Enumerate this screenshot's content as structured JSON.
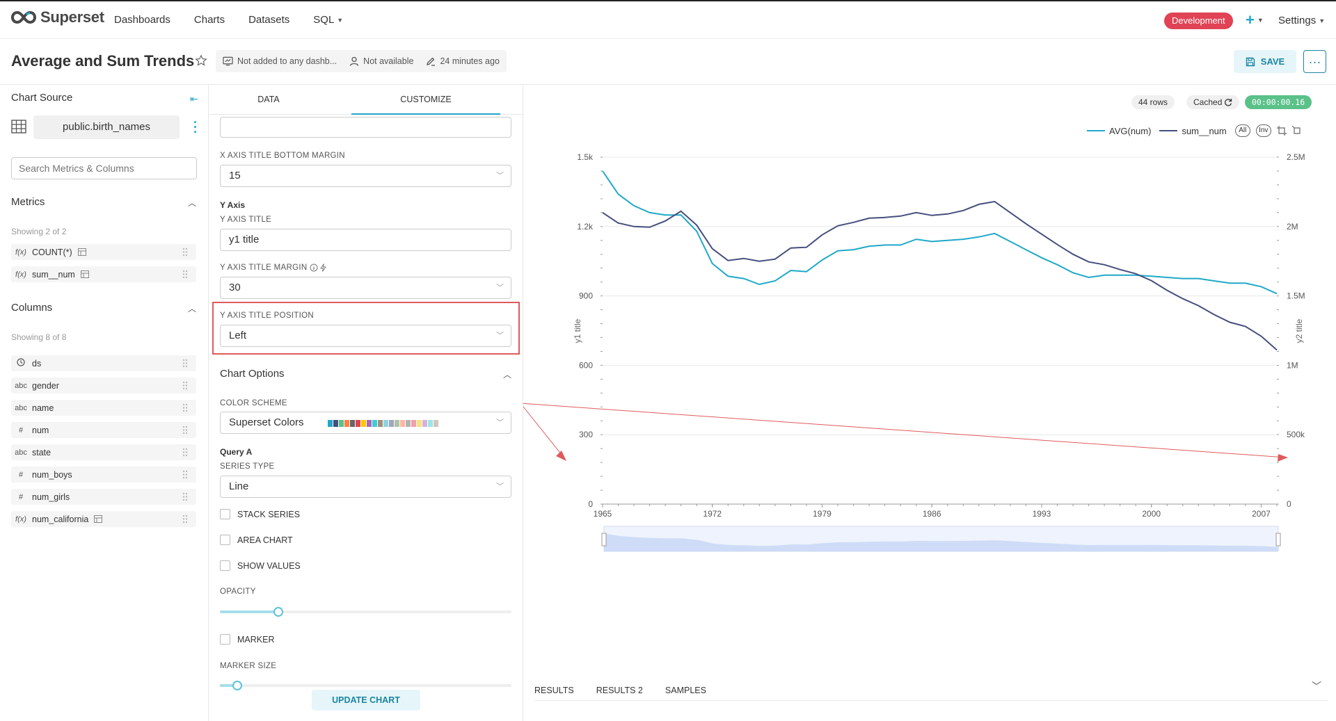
{
  "topbar": {
    "brand": "Superset",
    "nav": [
      {
        "label": "Dashboards"
      },
      {
        "label": "Charts"
      },
      {
        "label": "Datasets"
      },
      {
        "label": "SQL"
      }
    ],
    "env_badge": "Development",
    "settings_label": "Settings"
  },
  "header": {
    "title": "Average and Sum Trends",
    "meta": {
      "dashboards": "Not added to any dashb...",
      "owner": "Not available",
      "modified": "24 minutes ago"
    },
    "save_label": "SAVE",
    "more_label": "···"
  },
  "left": {
    "chart_source_label": "Chart Source",
    "dataset_name": "public.birth_names",
    "search_placeholder": "Search Metrics & Columns",
    "metrics_label": "Metrics",
    "metrics_showing": "Showing 2 of 2",
    "metrics": [
      {
        "icon": "f(x)",
        "name": "COUNT(*)"
      },
      {
        "icon": "f(x)",
        "name": "sum__num"
      }
    ],
    "columns_label": "Columns",
    "columns_showing": "Showing 8 of 8",
    "columns": [
      {
        "icon": "clock",
        "name": "ds"
      },
      {
        "icon": "abc",
        "name": "gender"
      },
      {
        "icon": "abc",
        "name": "name"
      },
      {
        "icon": "#",
        "name": "num"
      },
      {
        "icon": "abc",
        "name": "state"
      },
      {
        "icon": "#",
        "name": "num_boys"
      },
      {
        "icon": "#",
        "name": "num_girls"
      },
      {
        "icon": "f(x)",
        "name": "num_california"
      }
    ]
  },
  "mid": {
    "tabs": [
      {
        "label": "DATA"
      },
      {
        "label": "CUSTOMIZE"
      }
    ],
    "x_axis_title_bottom_margin_label": "X AXIS TITLE BOTTOM MARGIN",
    "x_axis_title_bottom_margin": "15",
    "y_axis_heading": "Y Axis",
    "y_axis_title_label": "Y AXIS TITLE",
    "y_axis_title": "y1 title",
    "y_axis_title_margin_label": "Y AXIS TITLE MARGIN",
    "y_axis_title_margin": "30",
    "y_axis_title_position_label": "Y AXIS TITLE POSITION",
    "y_axis_title_position": "Left",
    "chart_options_label": "Chart Options",
    "color_scheme_label": "COLOR SCHEME",
    "color_scheme": "Superset Colors",
    "color_swatches": [
      "#1fa8c9",
      "#454e7c",
      "#5ac189",
      "#ff7f44",
      "#666666",
      "#e04355",
      "#fcc700",
      "#a868b7",
      "#3cccda",
      "#a38f79",
      "#8fd3e4",
      "#a1a6bd",
      "#acc3a8",
      "#fdb8a2",
      "#b2b2b2",
      "#efa1aa",
      "#fddf80",
      "#d3b3da",
      "#9ee5e5",
      "#d1c6bc"
    ],
    "query_a_label": "Query A",
    "series_type_label": "SERIES TYPE",
    "series_type": "Line",
    "stack_series_label": "STACK SERIES",
    "area_chart_label": "AREA CHART",
    "show_values_label": "SHOW VALUES",
    "opacity_label": "OPACITY",
    "opacity_value": 0.2,
    "marker_label": "MARKER",
    "marker_size_label": "MARKER SIZE",
    "marker_size_value": 0.06,
    "update_label": "UPDATE CHART"
  },
  "right": {
    "rows_label": "44 rows",
    "cached_label": "Cached",
    "timer_label": "00:00:00.16",
    "legend_all": "All",
    "legend_inv": "Inv",
    "bottom_tabs": [
      {
        "label": "RESULTS"
      },
      {
        "label": "RESULTS 2"
      },
      {
        "label": "SAMPLES"
      }
    ],
    "y1_axis_title": "y1 title",
    "y2_axis_title": "y2 title"
  },
  "chart_data": {
    "type": "line",
    "title": "",
    "xlabel": "",
    "ylabel": "y1 title",
    "ylabel_right": "y2 title",
    "x": [
      1965,
      1966,
      1967,
      1968,
      1969,
      1970,
      1971,
      1972,
      1973,
      1974,
      1975,
      1976,
      1977,
      1978,
      1979,
      1980,
      1981,
      1982,
      1983,
      1984,
      1985,
      1986,
      1987,
      1988,
      1989,
      1990,
      1991,
      1992,
      1993,
      1994,
      1995,
      1996,
      1997,
      1998,
      1999,
      2000,
      2001,
      2002,
      2003,
      2004,
      2005,
      2006,
      2007,
      2008
    ],
    "xticks": [
      1965,
      1972,
      1979,
      1986,
      1993,
      2000,
      2007
    ],
    "xlim": [
      1965,
      2008
    ],
    "ylim": [
      0,
      1500
    ],
    "yticks": [
      0,
      300,
      600,
      900,
      "1.2k",
      "1.5k"
    ],
    "ylim_right": [
      0,
      2500000
    ],
    "yticks_right": [
      "0",
      "500k",
      "1M",
      "1.5M",
      "2M",
      "2.5M"
    ],
    "grid": true,
    "legend": "top-right",
    "series": [
      {
        "name": "AVG(num)",
        "axis": "left",
        "color": "#1fa8c9",
        "values": [
          1440,
          1340,
          1290,
          1260,
          1250,
          1250,
          1180,
          1040,
          985,
          975,
          950,
          965,
          1010,
          1005,
          1055,
          1095,
          1100,
          1115,
          1120,
          1120,
          1145,
          1135,
          1140,
          1145,
          1155,
          1170,
          1135,
          1100,
          1065,
          1035,
          1000,
          980,
          990,
          990,
          990,
          985,
          980,
          975,
          975,
          965,
          955,
          955,
          940,
          910
        ]
      },
      {
        "name": "sum__num",
        "axis": "right",
        "color": "#454e7c",
        "values": [
          2100000,
          2025000,
          2000000,
          1995000,
          2040000,
          2110000,
          2010000,
          1840000,
          1755000,
          1770000,
          1750000,
          1765000,
          1845000,
          1850000,
          1940000,
          2005000,
          2030000,
          2060000,
          2065000,
          2075000,
          2100000,
          2080000,
          2090000,
          2115000,
          2160000,
          2180000,
          2100000,
          2020000,
          1945000,
          1870000,
          1800000,
          1745000,
          1725000,
          1690000,
          1660000,
          1610000,
          1540000,
          1480000,
          1430000,
          1365000,
          1310000,
          1280000,
          1210000,
          1110000
        ]
      }
    ]
  }
}
